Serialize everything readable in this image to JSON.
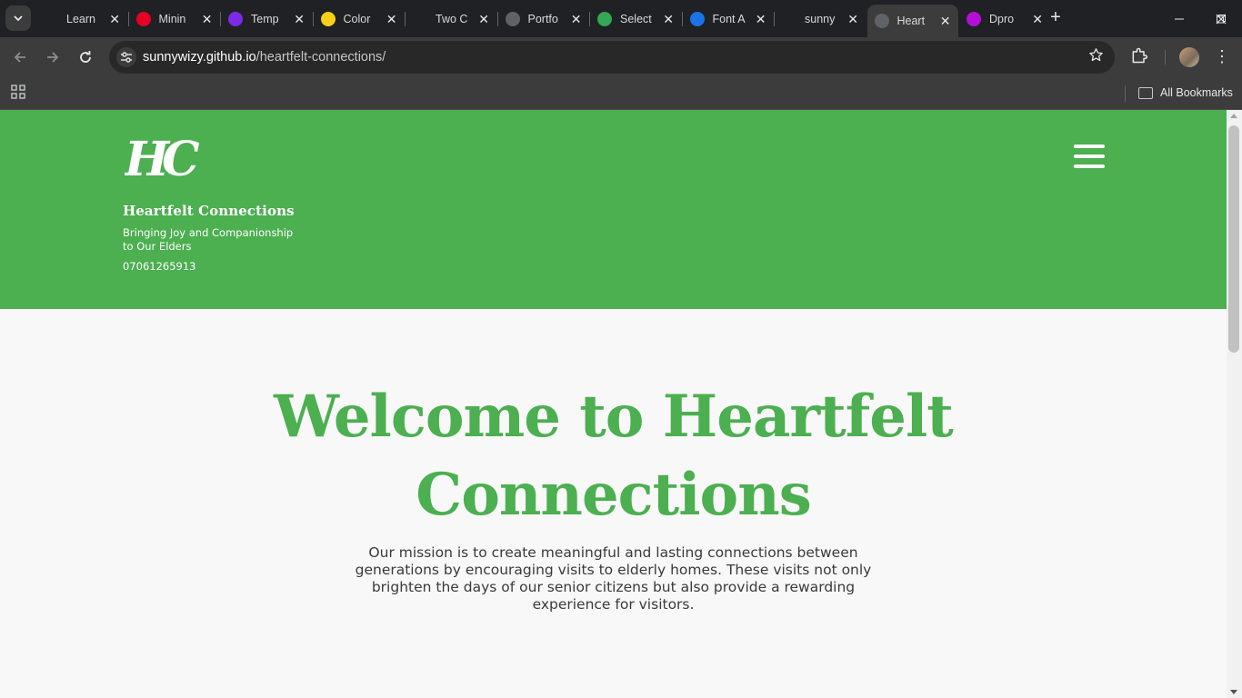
{
  "browser": {
    "tabs": [
      {
        "label": "Learn",
        "icon": "learn-site-icon",
        "color": "#202124"
      },
      {
        "label": "Minin",
        "icon": "pinterest-icon",
        "color": "#e60023"
      },
      {
        "label": "Temp",
        "icon": "canva-icon",
        "color": "#7d2ae8"
      },
      {
        "label": "Color",
        "icon": "colors-icon",
        "color": "#f7d117"
      },
      {
        "label": "Two C",
        "icon": "openai-icon",
        "color": "#202124"
      },
      {
        "label": "Portfo",
        "icon": "globe-icon",
        "color": "#5f6368"
      },
      {
        "label": "Select",
        "icon": "selection-icon",
        "color": "#34a853"
      },
      {
        "label": "Font A",
        "icon": "font-awesome-icon",
        "color": "#1a73e8"
      },
      {
        "label": "sunny",
        "icon": "github-icon",
        "color": "#202124"
      },
      {
        "label": "Heart",
        "icon": "globe-icon",
        "color": "#5f6368",
        "active": true
      },
      {
        "label": "Dpro",
        "icon": "dpro-icon",
        "color": "#b40fd8"
      }
    ],
    "url_domain": "sunnywizy.github.io",
    "url_path": "/heartfelt-connections/",
    "all_bookmarks": "All Bookmarks"
  },
  "site": {
    "logo_text": "HC",
    "brand_name": "Heartfelt Connections",
    "tagline": "Bringing Joy and Companionship to Our Elders",
    "phone": "07061265913",
    "hero": {
      "title": "Welcome to Heartfelt Connections",
      "text": "Our mission is to create meaningful and lasting connections between generations by encouraging visits to elderly homes. These visits not only brighten the days of our senior citizens but also provide a rewarding experience for visitors."
    },
    "colors": {
      "brand_green": "#4caf50",
      "page_bg": "#f8f8f8"
    }
  }
}
